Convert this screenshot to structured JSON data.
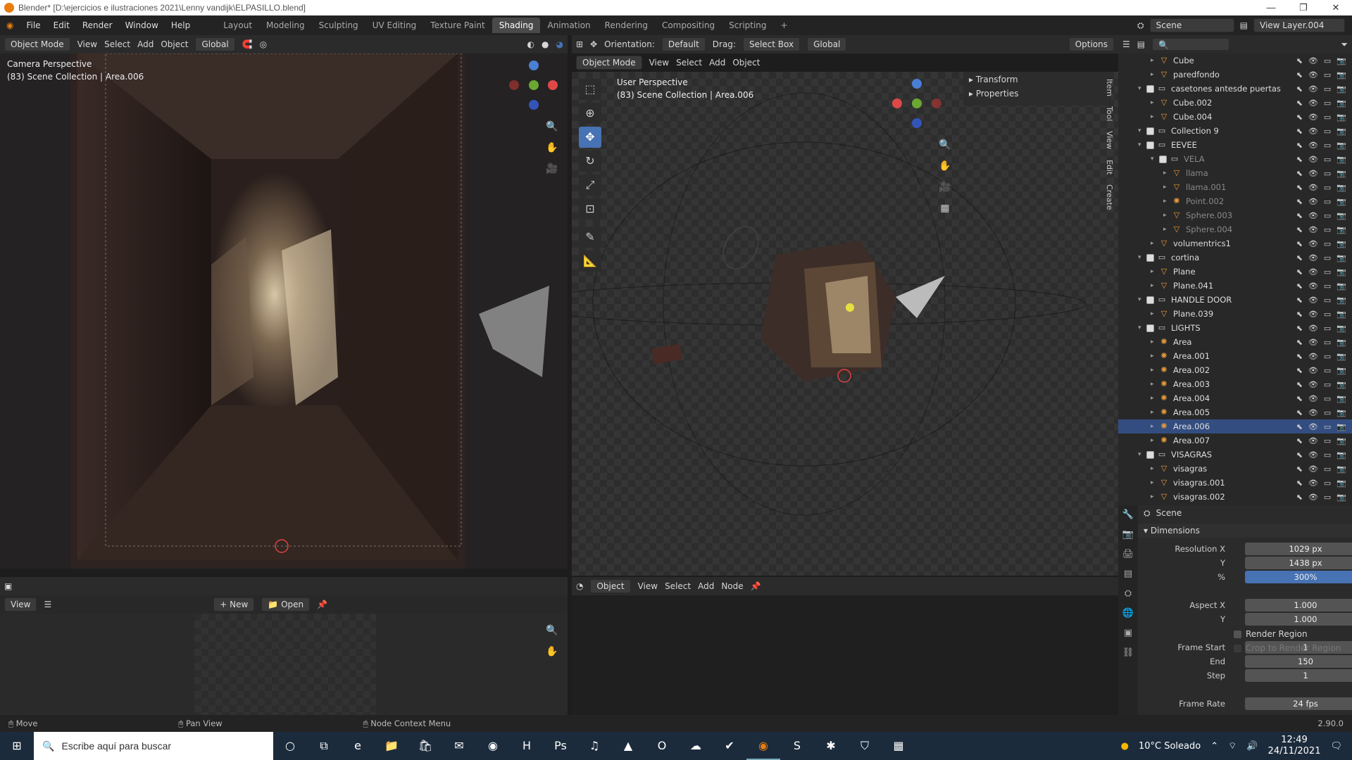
{
  "window": {
    "title": "Blender* [D:\\ejercicios e ilustraciones 2021\\Lenny vandijk\\ELPASILLO.blend]",
    "min": "—",
    "max": "❐",
    "close": "✕"
  },
  "menu": [
    "File",
    "Edit",
    "Render",
    "Window",
    "Help"
  ],
  "workspaces": [
    "Layout",
    "Modeling",
    "Sculpting",
    "UV Editing",
    "Texture Paint",
    "Shading",
    "Animation",
    "Rendering",
    "Compositing",
    "Scripting"
  ],
  "active_workspace": "Shading",
  "scene_name": "Scene",
  "view_layer": "View Layer.004",
  "left_viewport": {
    "mode": "Object Mode",
    "menus": [
      "View",
      "Select",
      "Add",
      "Object"
    ],
    "transform": "Global",
    "overlay_title": "Camera Perspective",
    "overlay_sub": "(83) Scene Collection | Area.006"
  },
  "right_viewport": {
    "orientation_label": "Orientation:",
    "orientation": "Default",
    "drag_label": "Drag:",
    "drag": "Select Box",
    "transform": "Global",
    "options": "Options",
    "mode": "Object Mode",
    "menus": [
      "View",
      "Select",
      "Add",
      "Object"
    ],
    "overlay_title": "User Perspective",
    "overlay_sub": "(83) Scene Collection | Area.006",
    "npanel": [
      "Transform",
      "Properties"
    ],
    "tabs": [
      "Item",
      "Tool",
      "View",
      "Edit",
      "Create"
    ]
  },
  "image_editor": {
    "view": "View",
    "new": "New",
    "open": "Open"
  },
  "node_editor": {
    "type": "Object",
    "menus": [
      "View",
      "Select",
      "Add",
      "Node"
    ]
  },
  "outliner": [
    {
      "name": "Cube",
      "depth": 2,
      "icon": "mesh",
      "dim": false
    },
    {
      "name": "paredfondo",
      "depth": 2,
      "icon": "mesh",
      "dim": false
    },
    {
      "name": "casetones antesde puertas",
      "depth": 1,
      "icon": "collection",
      "dim": false,
      "check": true
    },
    {
      "name": "Cube.002",
      "depth": 2,
      "icon": "mesh",
      "dim": false
    },
    {
      "name": "Cube.004",
      "depth": 2,
      "icon": "mesh",
      "dim": false
    },
    {
      "name": "Collection 9",
      "depth": 1,
      "icon": "collection",
      "dim": false,
      "check": true
    },
    {
      "name": "EEVEE",
      "depth": 1,
      "icon": "collection",
      "dim": false,
      "check": true
    },
    {
      "name": "VELA",
      "depth": 2,
      "icon": "collection",
      "dim": true,
      "check": true
    },
    {
      "name": "llama",
      "depth": 3,
      "icon": "mesh",
      "dim": true
    },
    {
      "name": "llama.001",
      "depth": 3,
      "icon": "mesh",
      "dim": true
    },
    {
      "name": "Point.002",
      "depth": 3,
      "icon": "light",
      "dim": true
    },
    {
      "name": "Sphere.003",
      "depth": 3,
      "icon": "mesh",
      "dim": true
    },
    {
      "name": "Sphere.004",
      "depth": 3,
      "icon": "mesh",
      "dim": true
    },
    {
      "name": "volumentrics1",
      "depth": 2,
      "icon": "mesh",
      "dim": false
    },
    {
      "name": "cortina",
      "depth": 1,
      "icon": "collection",
      "dim": false,
      "check": true
    },
    {
      "name": "Plane",
      "depth": 2,
      "icon": "mesh",
      "dim": false
    },
    {
      "name": "Plane.041",
      "depth": 2,
      "icon": "mesh",
      "dim": false
    },
    {
      "name": "HANDLE DOOR",
      "depth": 1,
      "icon": "collection",
      "dim": false,
      "check": true
    },
    {
      "name": "Plane.039",
      "depth": 2,
      "icon": "mesh",
      "dim": false
    },
    {
      "name": "LIGHTS",
      "depth": 1,
      "icon": "collection",
      "dim": false,
      "check": true
    },
    {
      "name": "Area",
      "depth": 2,
      "icon": "light",
      "dim": false
    },
    {
      "name": "Area.001",
      "depth": 2,
      "icon": "light",
      "dim": false
    },
    {
      "name": "Area.002",
      "depth": 2,
      "icon": "light",
      "dim": false
    },
    {
      "name": "Area.003",
      "depth": 2,
      "icon": "light",
      "dim": false
    },
    {
      "name": "Area.004",
      "depth": 2,
      "icon": "light",
      "dim": false
    },
    {
      "name": "Area.005",
      "depth": 2,
      "icon": "light",
      "dim": false
    },
    {
      "name": "Area.006",
      "depth": 2,
      "icon": "light",
      "dim": false,
      "selected": true
    },
    {
      "name": "Area.007",
      "depth": 2,
      "icon": "light",
      "dim": false
    },
    {
      "name": "VISAGRAS",
      "depth": 1,
      "icon": "collection",
      "dim": false,
      "check": true
    },
    {
      "name": "visagras",
      "depth": 2,
      "icon": "mesh",
      "dim": false
    },
    {
      "name": "visagras.001",
      "depth": 2,
      "icon": "mesh",
      "dim": false
    },
    {
      "name": "visagras.002",
      "depth": 2,
      "icon": "mesh",
      "dim": false
    }
  ],
  "properties": {
    "context": "Scene",
    "panel": "Dimensions",
    "rows": [
      {
        "label": "Resolution X",
        "value": "1029 px"
      },
      {
        "label": "Y",
        "value": "1438 px"
      },
      {
        "label": "%",
        "value": "300%",
        "blue": true
      },
      {
        "label": "",
        "value": ""
      },
      {
        "label": "Aspect X",
        "value": "1.000"
      },
      {
        "label": "Y",
        "value": "1.000"
      },
      {
        "label": "",
        "value": ""
      },
      {
        "label": "Frame Start",
        "value": "1"
      },
      {
        "label": "End",
        "value": "150"
      },
      {
        "label": "Step",
        "value": "1"
      },
      {
        "label": "",
        "value": ""
      },
      {
        "label": "Frame Rate",
        "value": "24 fps"
      }
    ],
    "render_region": "Render Region",
    "crop": "Crop to Render Region"
  },
  "statusbar": {
    "move": "Move",
    "pan": "Pan View",
    "ctx": "Node Context Menu",
    "version": "2.90.0"
  },
  "taskbar": {
    "search": "Escribe aquí para buscar",
    "weather": "10°C Soleado",
    "time": "12:49",
    "date": "24/11/2021"
  }
}
